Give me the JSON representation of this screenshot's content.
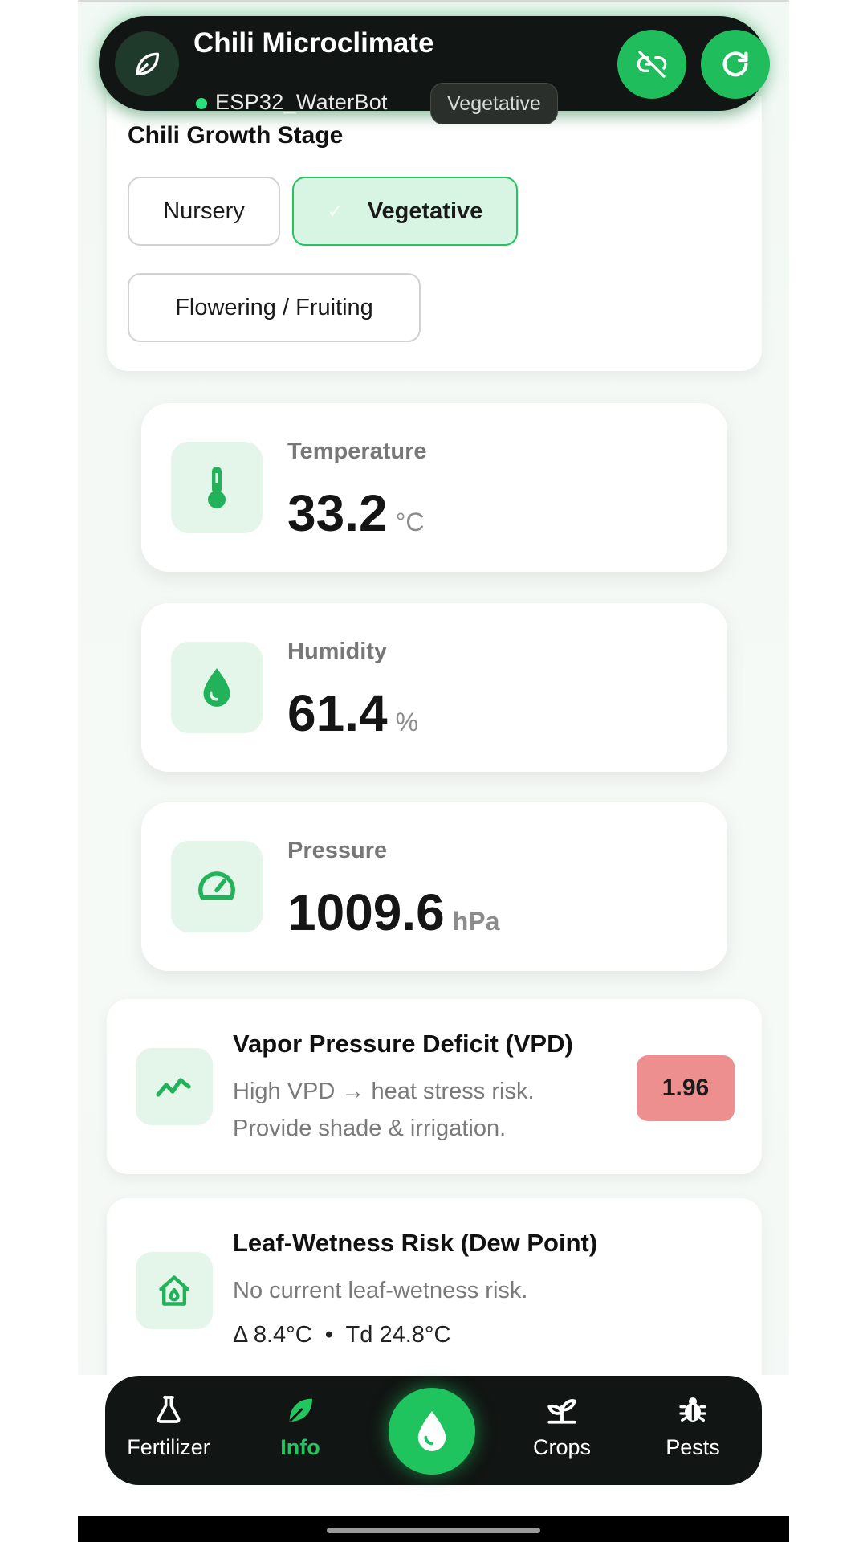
{
  "header": {
    "title": "Chili Microclimate",
    "device": "ESP32_WaterBot",
    "stage_chip": "Vegetative",
    "status_color": "#2ee07b",
    "icons": [
      "leaf-icon",
      "unlink-icon",
      "refresh-icon"
    ]
  },
  "growth_stage": {
    "title": "Chili Growth Stage",
    "options": [
      "Nursery",
      "Vegetative",
      "Flowering / Fruiting"
    ],
    "selected": "Vegetative"
  },
  "sensors": {
    "temperature": {
      "label": "Temperature",
      "value": "33.2",
      "unit": "°C",
      "icon": "thermometer-icon"
    },
    "humidity": {
      "label": "Humidity",
      "value": "61.4",
      "unit": "%",
      "icon": "droplet-icon"
    },
    "pressure": {
      "label": "Pressure",
      "value": "1009.6",
      "unit": "hPa",
      "icon": "gauge-icon"
    }
  },
  "vpd": {
    "title": "Vapor Pressure Deficit (VPD)",
    "line1": "High VPD → heat stress risk.",
    "line2": "Provide shade & irrigation.",
    "value": "1.96",
    "badge_color": "#ee8f8f",
    "icon": "trend-icon"
  },
  "leaf_wetness": {
    "title": "Leaf-Wetness Risk (Dew Point)",
    "description": "No current leaf-wetness risk.",
    "delta": "Δ 8.4°C  •  Td 24.8°C",
    "icon": "house-icon"
  },
  "nav": {
    "items": [
      {
        "label": "Fertilizer",
        "icon": "flask-icon"
      },
      {
        "label": "Info",
        "icon": "leaf-icon",
        "active": true
      },
      {
        "label": "Crops",
        "icon": "sprout-icon"
      },
      {
        "label": "Pests",
        "icon": "bug-icon"
      }
    ],
    "center_icon": "water-drop-icon"
  },
  "colors": {
    "accent": "#22c55e",
    "dark": "#111513",
    "icon_bg": "#e4f6ea"
  }
}
